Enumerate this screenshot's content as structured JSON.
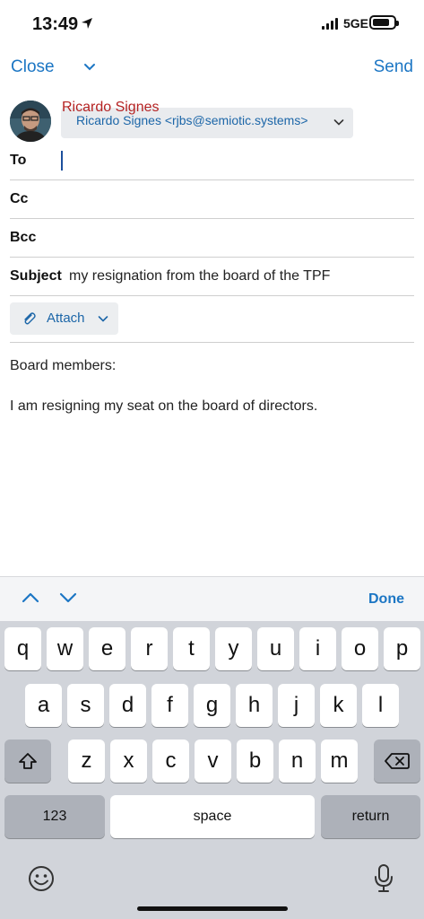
{
  "status_bar": {
    "time": "13:49",
    "network": "5GE"
  },
  "nav": {
    "close_label": "Close",
    "send_label": "Send"
  },
  "from": {
    "name": "Ricardo Signes",
    "address": "Ricardo Signes <rjbs@semiotic.systems>"
  },
  "fields": {
    "to_label": "To",
    "to_value": "",
    "cc_label": "Cc",
    "bcc_label": "Bcc",
    "subject_label": "Subject",
    "subject_value": "my resignation from the board of the TPF"
  },
  "attach": {
    "label": "Attach"
  },
  "body": {
    "line1": "Board members:",
    "line2": "I am resigning my seat on the board of directors."
  },
  "accessory": {
    "done_label": "Done"
  },
  "keyboard": {
    "row1": [
      "q",
      "w",
      "e",
      "r",
      "t",
      "y",
      "u",
      "i",
      "o",
      "p"
    ],
    "row2": [
      "a",
      "s",
      "d",
      "f",
      "g",
      "h",
      "j",
      "k",
      "l"
    ],
    "row3": [
      "z",
      "x",
      "c",
      "v",
      "b",
      "n",
      "m"
    ],
    "numbers_label": "123",
    "space_label": "space",
    "return_label": "return"
  },
  "colors": {
    "accent": "#1c76c4",
    "from_name": "#b52222",
    "keyboard_bg": "#d1d4da"
  }
}
